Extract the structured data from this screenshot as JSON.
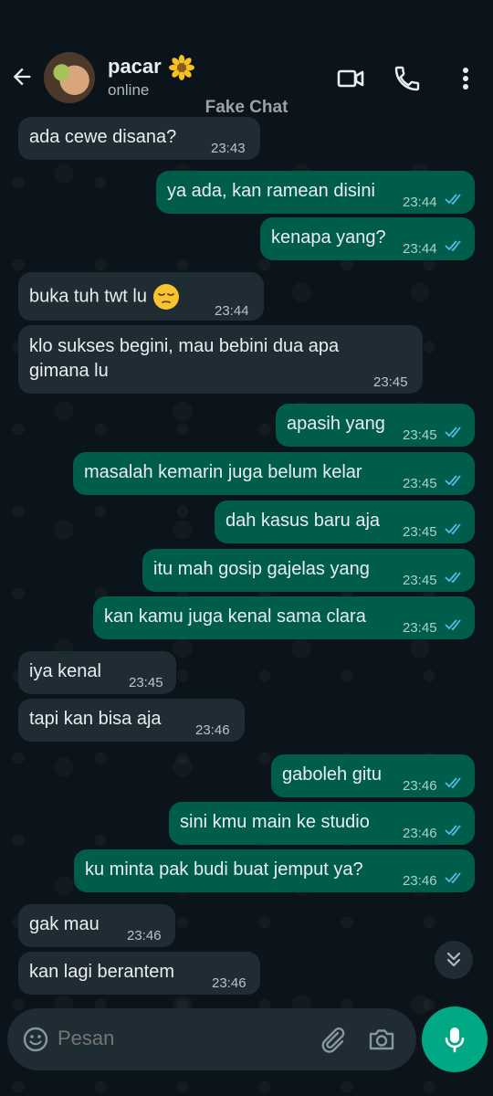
{
  "header": {
    "contact_name": "pacar",
    "contact_status": "online",
    "watermark": "Fake Chat"
  },
  "messages": [
    {
      "dir": "in",
      "text": "ada cewe disana?",
      "time": "23:43"
    },
    {
      "dir": "out",
      "text": "ya ada, kan ramean disini",
      "time": "23:44"
    },
    {
      "dir": "out",
      "text": "kenapa yang?",
      "time": "23:44"
    },
    {
      "dir": "in",
      "text": "buka tuh twt lu",
      "time": "23:44",
      "emoji": "unamused-face-emoji"
    },
    {
      "dir": "in",
      "text": "klo sukses begini, mau bebini dua apa gimana lu",
      "time": "23:45"
    },
    {
      "dir": "out",
      "text": "apasih yang",
      "time": "23:45"
    },
    {
      "dir": "out",
      "text": "masalah kemarin juga belum kelar",
      "time": "23:45"
    },
    {
      "dir": "out",
      "text": "dah kasus baru aja",
      "time": "23:45"
    },
    {
      "dir": "out",
      "text": "itu mah gosip gajelas yang",
      "time": "23:45"
    },
    {
      "dir": "out",
      "text": "kan kamu juga kenal sama clara",
      "time": "23:45"
    },
    {
      "dir": "in",
      "text": "iya kenal",
      "time": "23:45"
    },
    {
      "dir": "in",
      "text": "tapi kan bisa aja",
      "time": "23:46"
    },
    {
      "dir": "out",
      "text": "gaboleh gitu",
      "time": "23:46"
    },
    {
      "dir": "out",
      "text": "sini kmu main ke studio",
      "time": "23:46"
    },
    {
      "dir": "out",
      "text": "ku minta pak budi buat jemput ya?",
      "time": "23:46"
    },
    {
      "dir": "in",
      "text": "gak mau",
      "time": "23:46"
    },
    {
      "dir": "in",
      "text": "kan lagi berantem",
      "time": "23:46"
    }
  ],
  "composer": {
    "placeholder": "Pesan"
  },
  "colors": {
    "background": "#0b141a",
    "incoming_bubble": "#202c33",
    "outgoing_bubble": "#005c4b",
    "read_tick": "#53bdeb",
    "accent": "#00a884"
  },
  "icons": {
    "back": "arrow-left-icon",
    "video": "video-call-icon",
    "call": "phone-icon",
    "menu": "more-vert-icon",
    "emoji": "emoji-icon",
    "attach": "paperclip-icon",
    "camera": "camera-icon",
    "mic": "mic-icon",
    "scroll": "double-chevron-down-icon"
  }
}
